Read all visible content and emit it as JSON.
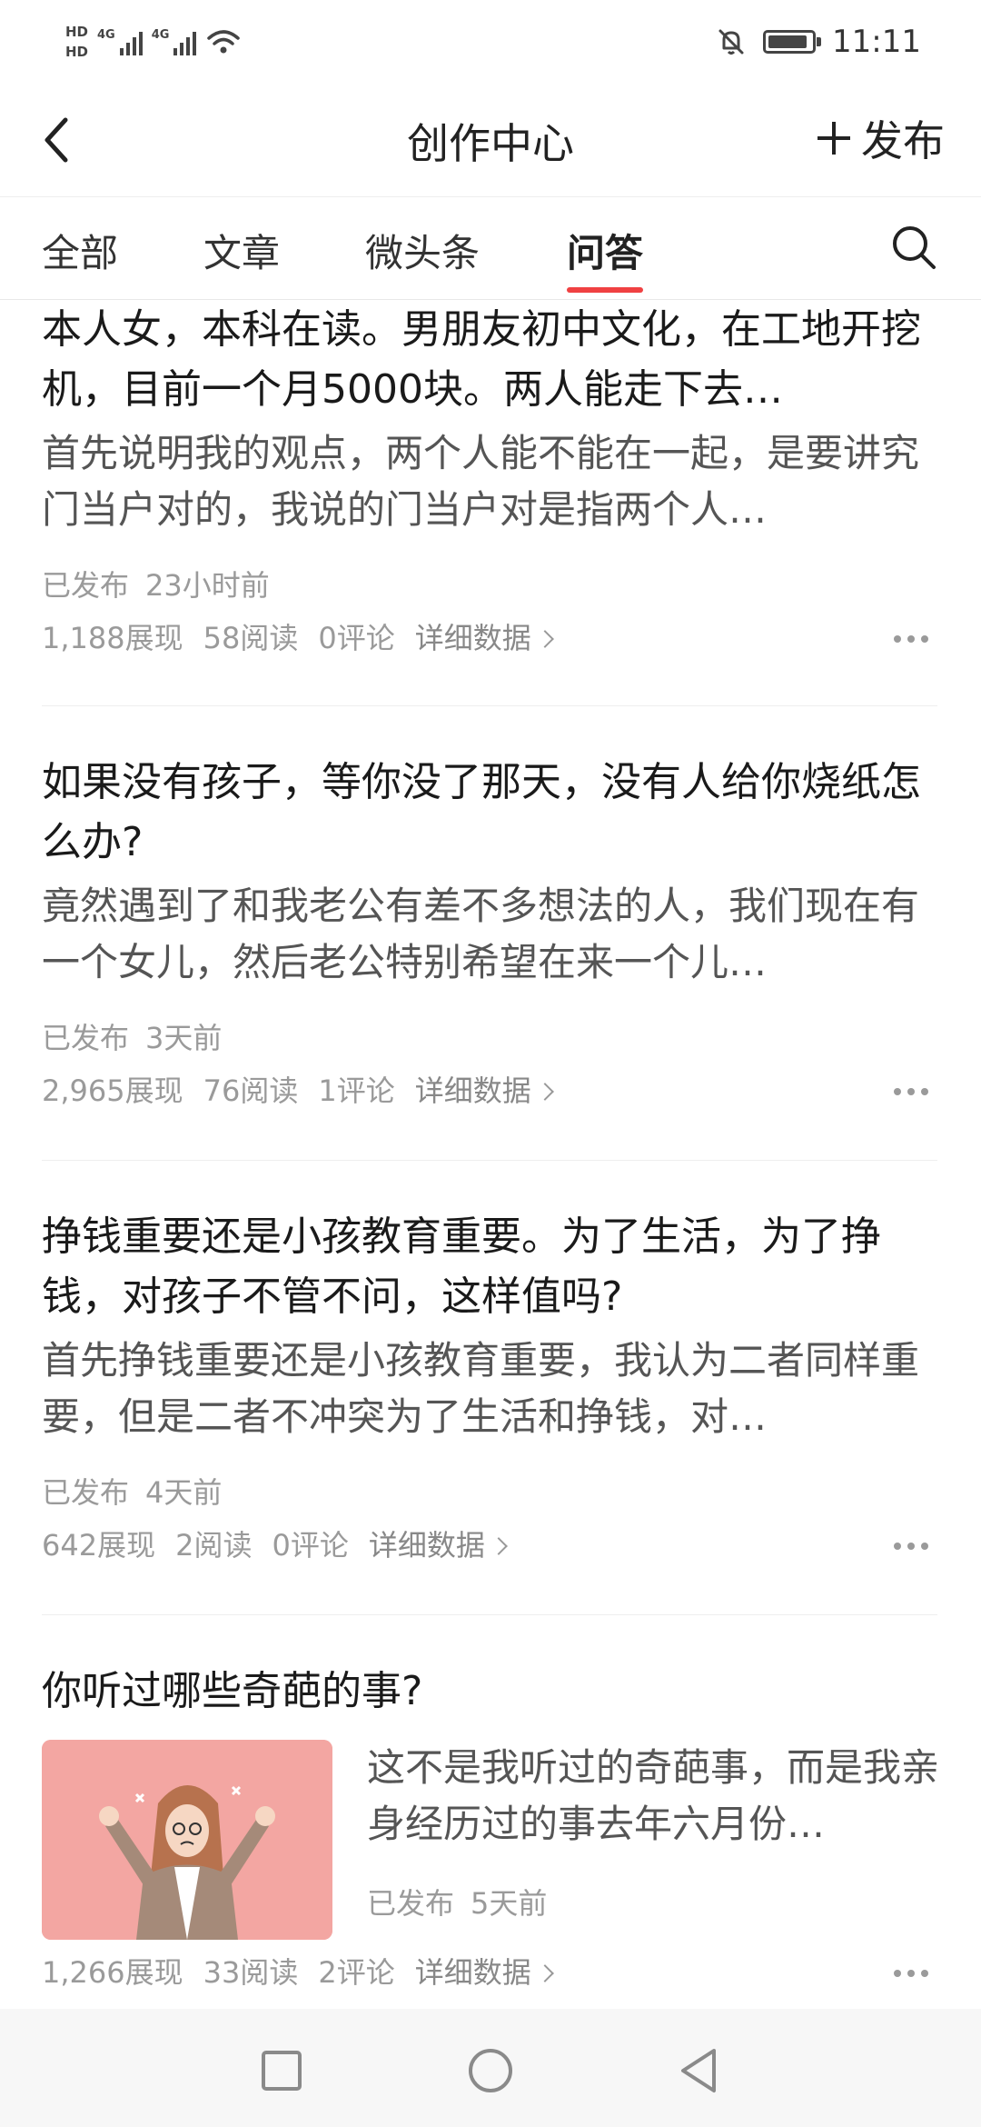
{
  "status_bar": {
    "sim1": "HD",
    "sim2": "HD",
    "net1": "4G",
    "net2": "4G",
    "time": "11:11",
    "icons": [
      "signal-icon",
      "wifi-icon",
      "bell-muted-icon",
      "battery-icon"
    ]
  },
  "header": {
    "title": "创作中心",
    "publish_label": "发布"
  },
  "tabs": [
    {
      "label": "全部",
      "active": false
    },
    {
      "label": "文章",
      "active": false
    },
    {
      "label": "微头条",
      "active": false
    },
    {
      "label": "问答",
      "active": true
    }
  ],
  "accent_color": "#f04142",
  "items": [
    {
      "title": "本人女，本科在读。男朋友初中文化，在工地开挖机，目前一个月5000块。两人能走下去…",
      "summary": "首先说明我的观点，两个人能不能在一起，是要讲究门当户对的，我说的门当户对是指两个人…",
      "status": "已发布",
      "time": "23小时前",
      "views": "1,188展现",
      "reads": "58阅读",
      "comments": "0评论",
      "detail": "详细数据"
    },
    {
      "title": "如果没有孩子，等你没了那天，没有人给你烧纸怎么办?",
      "summary": "竟然遇到了和我老公有差不多想法的人，我们现在有一个女儿，然后老公特别希望在来一个儿…",
      "status": "已发布",
      "time": "3天前",
      "views": "2,965展现",
      "reads": "76阅读",
      "comments": "1评论",
      "detail": "详细数据"
    },
    {
      "title": "挣钱重要还是小孩教育重要。为了生活，为了挣钱，对孩子不管不问，这样值吗?",
      "summary": "首先挣钱重要还是小孩教育重要，我认为二者同样重要，但是二者不冲突为了生活和挣钱，对…",
      "status": "已发布",
      "time": "4天前",
      "views": "642展现",
      "reads": "2阅读",
      "comments": "0评论",
      "detail": "详细数据"
    },
    {
      "title": "你听过哪些奇葩的事?",
      "summary": "这不是我听过的奇葩事，而是我亲身经历过的事去年六月份…",
      "status": "已发布",
      "time": "5天前",
      "views": "1,266展现",
      "reads": "33阅读",
      "comments": "2评论",
      "detail": "详细数据",
      "thumbnail": "frustrated-woman-illustration"
    }
  ],
  "nav": {
    "icons": [
      "recent-apps-icon",
      "home-icon",
      "back-icon"
    ]
  }
}
